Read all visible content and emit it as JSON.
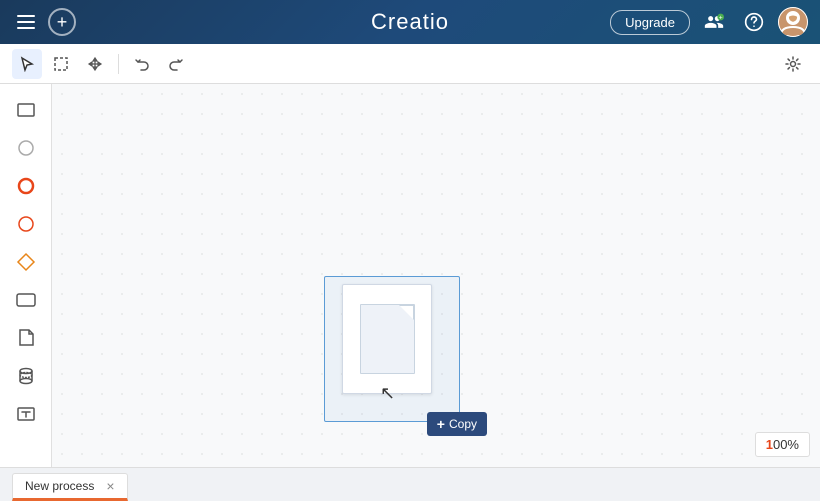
{
  "app": {
    "brand": "Creatio",
    "upgrade_label": "Upgrade"
  },
  "navbar": {
    "upgrade_label": "Upgrade",
    "icons": {
      "add_person": "add-person-icon",
      "help": "help-icon",
      "avatar": "avatar-icon"
    }
  },
  "toolbar": {
    "tools": [
      {
        "id": "select",
        "label": "Select"
      },
      {
        "id": "rect-select",
        "label": "Rectangle Select"
      },
      {
        "id": "move",
        "label": "Move"
      },
      {
        "id": "undo",
        "label": "Undo"
      },
      {
        "id": "redo",
        "label": "Redo"
      }
    ],
    "settings_label": "Settings"
  },
  "left_panel": {
    "tools": [
      {
        "id": "rectangle",
        "label": "Rectangle"
      },
      {
        "id": "circle",
        "label": "Circle"
      },
      {
        "id": "event-circle",
        "label": "Event Circle"
      },
      {
        "id": "event-circle-2",
        "label": "Event Circle 2"
      },
      {
        "id": "diamond",
        "label": "Diamond"
      },
      {
        "id": "subprocess",
        "label": "Subprocess"
      },
      {
        "id": "document",
        "label": "Document"
      },
      {
        "id": "database",
        "label": "Database"
      },
      {
        "id": "text",
        "label": "Text"
      }
    ]
  },
  "canvas": {
    "copy_label": "+ Copy",
    "zoom": "100%"
  },
  "tabs": [
    {
      "id": "new-process",
      "label": "New process",
      "active": true
    }
  ]
}
